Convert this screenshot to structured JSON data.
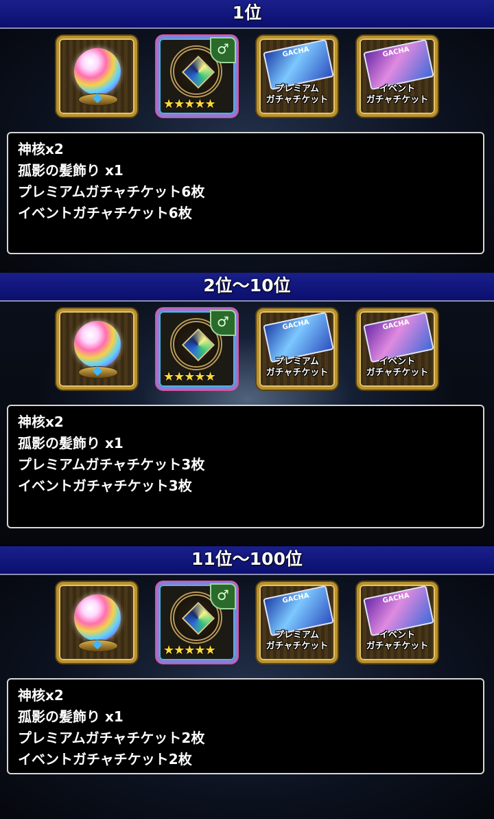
{
  "tiers": [
    {
      "rank": "1位",
      "items": [
        {
          "name": "sphere",
          "icon": "rainbow-orb-icon"
        },
        {
          "name": "hair-ornament",
          "icon": "hair-ornament-icon",
          "rarity_stars": 5
        },
        {
          "name": "premium-ticket",
          "icon": "gacha-ticket-icon",
          "label": "プレミアム\nガチャチケット",
          "ticket_word": "GACHA"
        },
        {
          "name": "event-ticket",
          "icon": "gacha-ticket-icon",
          "label": "イベント\nガチャチケット",
          "ticket_word": "GACHA"
        }
      ],
      "lines": [
        "神核x2",
        "孤影の髪飾り x1",
        "プレミアムガチャチケット6枚",
        "イベントガチャチケット6枚"
      ]
    },
    {
      "rank": "2位～10位",
      "items": [
        {
          "name": "sphere",
          "icon": "rainbow-orb-icon"
        },
        {
          "name": "hair-ornament",
          "icon": "hair-ornament-icon",
          "rarity_stars": 5
        },
        {
          "name": "premium-ticket",
          "icon": "gacha-ticket-icon",
          "label": "プレミアム\nガチャチケット",
          "ticket_word": "GACHA"
        },
        {
          "name": "event-ticket",
          "icon": "gacha-ticket-icon",
          "label": "イベント\nガチャチケット",
          "ticket_word": "GACHA"
        }
      ],
      "lines": [
        "神核x2",
        "孤影の髪飾り x1",
        "プレミアムガチャチケット3枚",
        "イベントガチャチケット3枚"
      ]
    },
    {
      "rank": "11位～100位",
      "items": [
        {
          "name": "sphere",
          "icon": "rainbow-orb-icon"
        },
        {
          "name": "hair-ornament",
          "icon": "hair-ornament-icon",
          "rarity_stars": 5
        },
        {
          "name": "premium-ticket",
          "icon": "gacha-ticket-icon",
          "label": "プレミアム\nガチャチケット",
          "ticket_word": "GACHA"
        },
        {
          "name": "event-ticket",
          "icon": "gacha-ticket-icon",
          "label": "イベント\nガチャチケット",
          "ticket_word": "GACHA"
        }
      ],
      "lines": [
        "神核x2",
        "孤影の髪飾り x1",
        "プレミアムガチャチケット2枚",
        "イベントガチャチケット2枚"
      ]
    }
  ],
  "colors": {
    "header_blue": "#0b0f6e",
    "frame_gold": "#b9922e",
    "star_yellow": "#ffd93a"
  }
}
